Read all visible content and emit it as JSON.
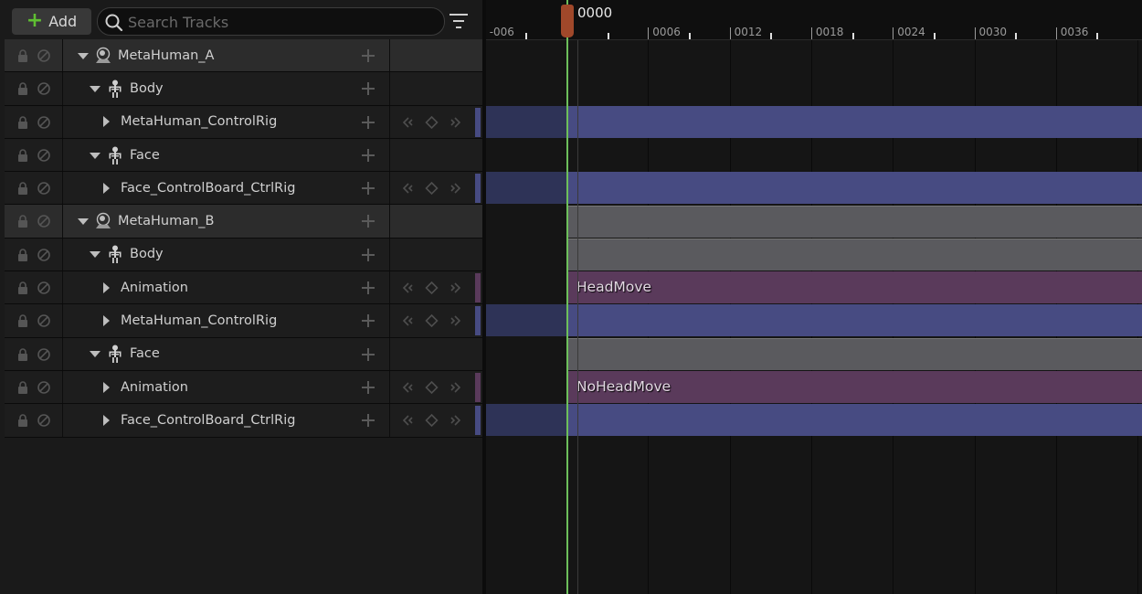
{
  "toolbar": {
    "add_label": "Add",
    "search_placeholder": "Search Tracks"
  },
  "tracks": [
    {
      "label": "MetaHuman_A",
      "level": 0,
      "kind": "actor",
      "expanded": true,
      "keys": false
    },
    {
      "label": "Body",
      "level": 1,
      "kind": "skeleton",
      "expanded": true,
      "keys": false
    },
    {
      "label": "MetaHuman_ControlRig",
      "level": 2,
      "kind": "track",
      "expanded": false,
      "keys": true,
      "color": "#474b82"
    },
    {
      "label": "Face",
      "level": 1,
      "kind": "skeleton",
      "expanded": true,
      "keys": false
    },
    {
      "label": "Face_ControlBoard_CtrlRig",
      "level": 2,
      "kind": "track",
      "expanded": false,
      "keys": true,
      "color": "#474b82"
    },
    {
      "label": "MetaHuman_B",
      "level": 0,
      "kind": "actor",
      "expanded": true,
      "keys": false
    },
    {
      "label": "Body",
      "level": 1,
      "kind": "skeleton",
      "expanded": true,
      "keys": false
    },
    {
      "label": "Animation",
      "level": 2,
      "kind": "track",
      "expanded": false,
      "keys": true,
      "color": "#5a3a5b"
    },
    {
      "label": "MetaHuman_ControlRig",
      "level": 2,
      "kind": "track",
      "expanded": false,
      "keys": true,
      "color": "#474b82"
    },
    {
      "label": "Face",
      "level": 1,
      "kind": "skeleton",
      "expanded": true,
      "keys": false
    },
    {
      "label": "Animation",
      "level": 2,
      "kind": "track",
      "expanded": false,
      "keys": true,
      "color": "#5a3a5b"
    },
    {
      "label": "Face_ControlBoard_CtrlRig",
      "level": 2,
      "kind": "track",
      "expanded": false,
      "keys": true,
      "color": "#474b82"
    }
  ],
  "timeline": {
    "current_frame": "0000",
    "tick_labels": [
      "-006",
      "0006",
      "0012",
      "0018",
      "0024",
      "0030",
      "0036"
    ],
    "sections": [
      {
        "row": 2,
        "type": "blue",
        "label": ""
      },
      {
        "row": 4,
        "type": "blue",
        "label": ""
      },
      {
        "row": 5,
        "type": "gray",
        "label": ""
      },
      {
        "row": 6,
        "type": "gray",
        "label": ""
      },
      {
        "row": 7,
        "type": "purple",
        "label": "HeadMove"
      },
      {
        "row": 8,
        "type": "blue",
        "label": ""
      },
      {
        "row": 9,
        "type": "gray",
        "label": ""
      },
      {
        "row": 10,
        "type": "purple",
        "label": "NoHeadMove"
      },
      {
        "row": 11,
        "type": "blue",
        "label": ""
      }
    ]
  },
  "colors": {
    "playhead": "#a0482a",
    "playhead_line": "#6dbf5b",
    "control_rig": "#474b82",
    "animation": "#5a3a5b",
    "actor_section": "#5a5a5e",
    "add_plus": "#5fbf32"
  }
}
